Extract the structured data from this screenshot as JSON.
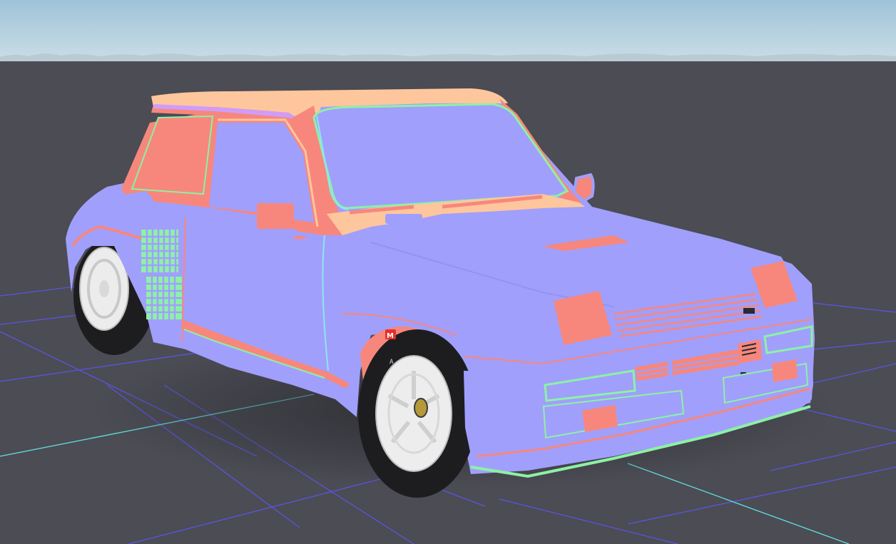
{
  "viewport": {
    "sky_top_color": "#a9c9dc",
    "sky_bottom_color": "#c7dbe6",
    "ground_color": "#4b4c54",
    "grid_color": "#5a55e0",
    "grid_axis_color": "#5fd8d8"
  },
  "car": {
    "body_color": "#a19ffc",
    "roof_color": "#fec69d",
    "accent_color": "#f7877c",
    "edge_color": "#8cf2a4",
    "tire_color": "#1e1e20",
    "rim_color": "#f0f0f0",
    "brand_badge_letter": "M",
    "tire_mark_letter": "A"
  }
}
